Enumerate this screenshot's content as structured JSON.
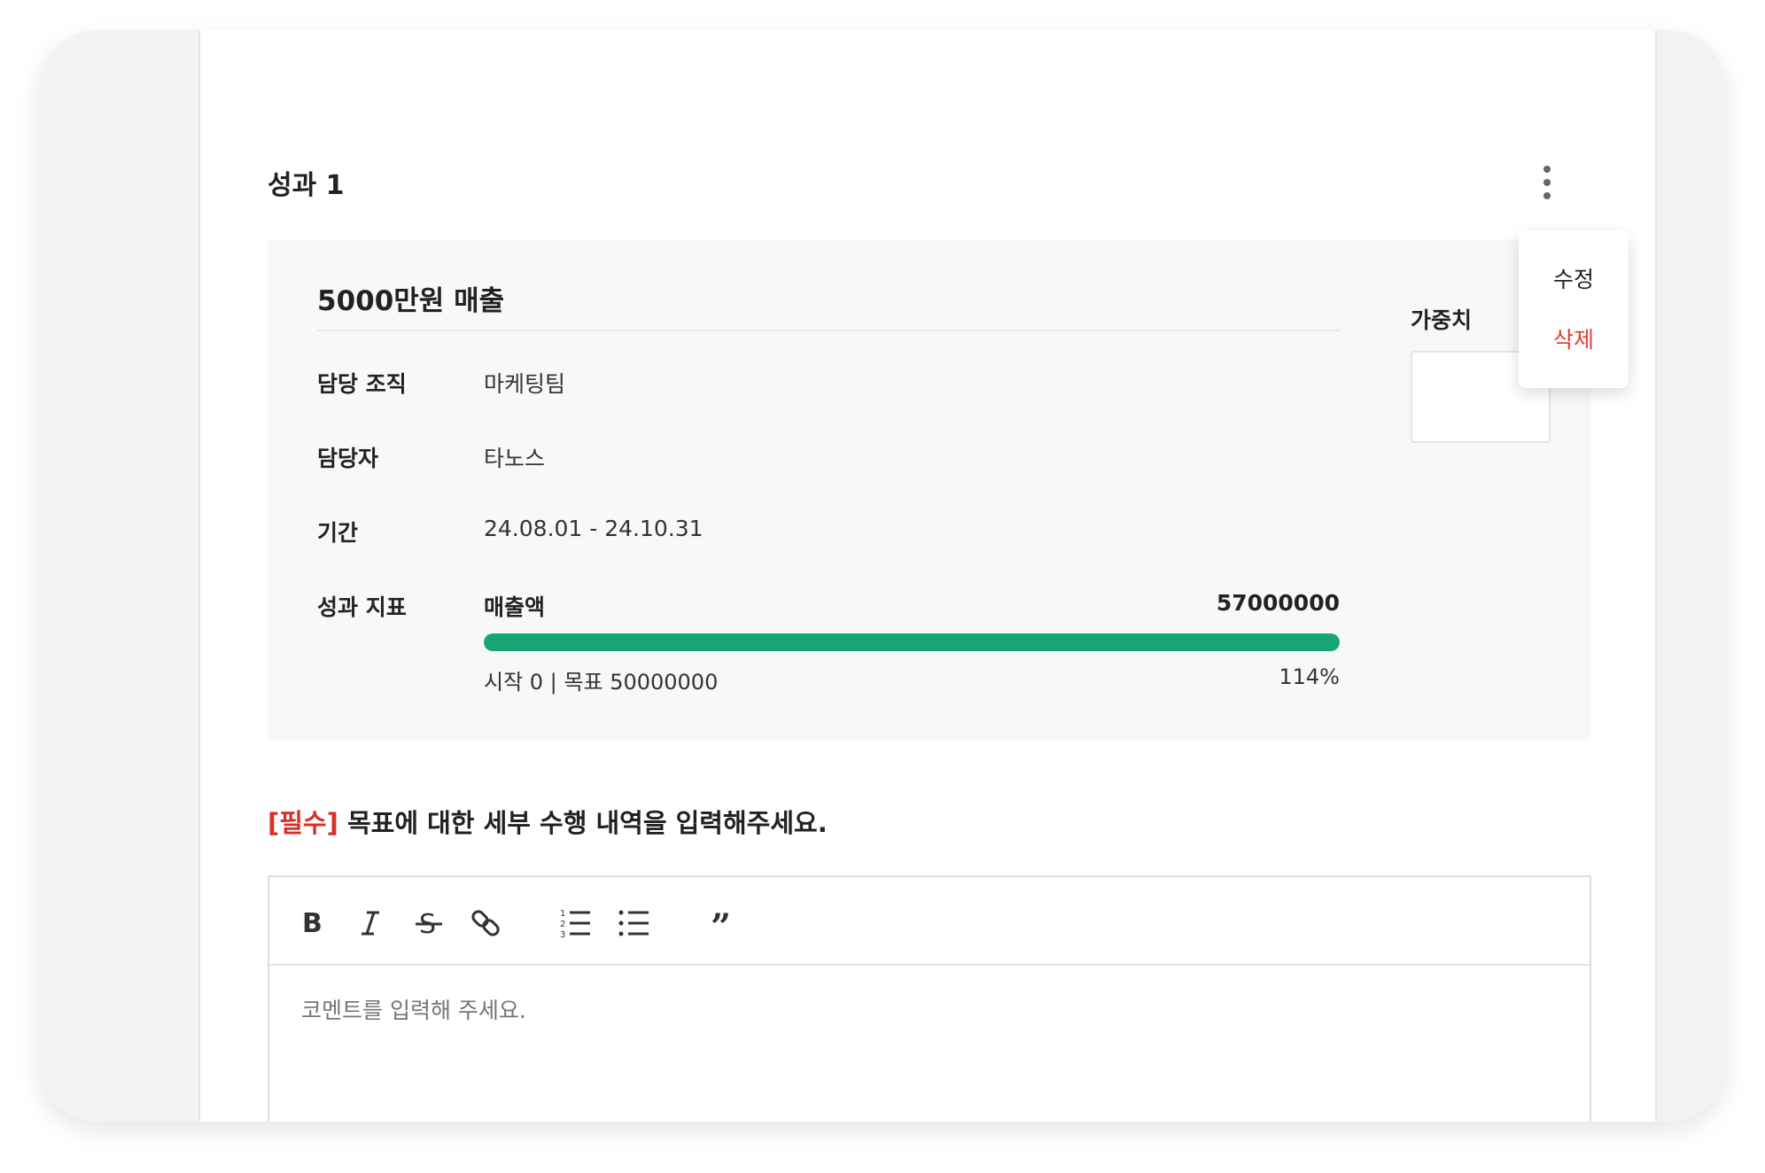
{
  "section": {
    "title": "성과 1"
  },
  "card": {
    "goal_title": "5000만원 매출",
    "rows": [
      {
        "label": "담당 조직",
        "value": "마케팅팀"
      },
      {
        "label": "담당자",
        "value": "타노스"
      },
      {
        "label": "기간",
        "value": "24.08.01 - 24.10.31"
      }
    ],
    "kpi": {
      "label": "성과 지표",
      "name": "매출액",
      "current": "57000000",
      "range_text": "시작 0 | 목표 50000000",
      "percent_text": "114%",
      "progress_fraction": 1.0
    },
    "weight": {
      "label": "가중치",
      "value": ""
    }
  },
  "menu": {
    "edit": "수정",
    "delete": "삭제"
  },
  "comment": {
    "required_tag": "[필수]",
    "prompt": " 목표에 대한 세부 수행 내역을 입력해주세요.",
    "placeholder": "코멘트를 입력해 주세요.",
    "toolbar": [
      "bold-icon",
      "italic-icon",
      "strikethrough-icon",
      "link-icon",
      "ordered-list-icon",
      "bullet-list-icon",
      "quote-icon"
    ]
  },
  "colors": {
    "progress": "#17a673",
    "delete": "#e0413b",
    "required": "#d93025"
  }
}
